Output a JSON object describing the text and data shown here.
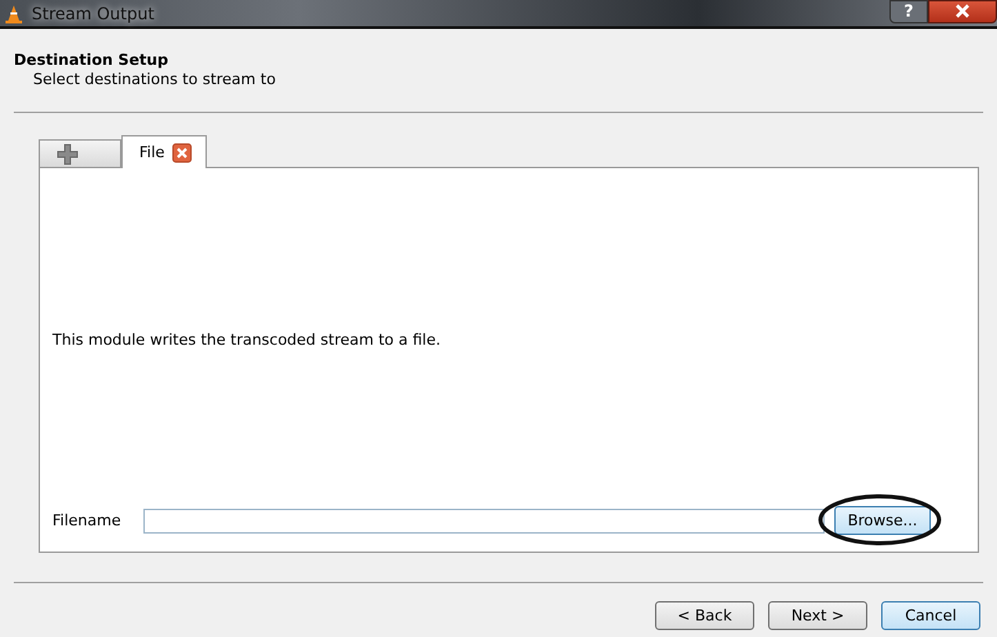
{
  "window": {
    "title": "Stream Output",
    "help_button": "?"
  },
  "header": {
    "title": "Destination Setup",
    "subtitle": "Select destinations to stream to"
  },
  "tabs": [
    {
      "kind": "add",
      "selected": false
    },
    {
      "kind": "named",
      "label": "File",
      "selected": true
    }
  ],
  "panel": {
    "description": "This module writes the transcoded stream to a file.",
    "filename_label": "Filename",
    "browse_button": "Browse...",
    "browse_highlighted": true
  },
  "buttons": [
    {
      "label": "< Back",
      "default": false
    },
    {
      "label": "Next >",
      "default": false
    },
    {
      "label": "Cancel",
      "default": true
    }
  ]
}
